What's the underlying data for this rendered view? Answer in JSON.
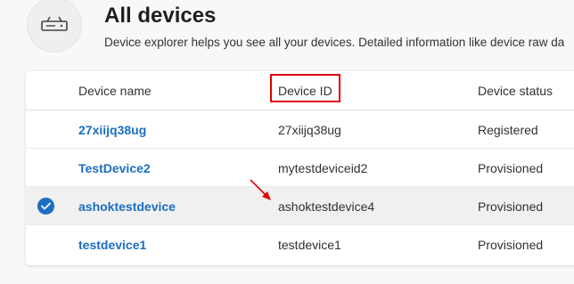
{
  "page": {
    "title": "All devices",
    "subtitle": "Device explorer helps you see all your devices. Detailed information like device raw da",
    "icon": "router-icon"
  },
  "table": {
    "columns": [
      "Device name",
      "Device ID",
      "Device status"
    ],
    "rows": [
      {
        "name": "27xiijq38ug",
        "id": "27xiijq38ug",
        "status": "Registered",
        "selected": false
      },
      {
        "name": "TestDevice2",
        "id": "mytestdeviceid2",
        "status": "Provisioned",
        "selected": false
      },
      {
        "name": "ashoktestdevice",
        "id": "ashoktestdevice4",
        "status": "Provisioned",
        "selected": true
      },
      {
        "name": "testdevice1",
        "id": "testdevice1",
        "status": "Provisioned",
        "selected": false
      }
    ]
  },
  "annotations": {
    "highlight_color": "#e00000",
    "highlighted_column": "Device ID",
    "arrow_target": "ashoktestdevice4"
  },
  "colors": {
    "accent": "#1b6ec2",
    "background": "#f8f8f8",
    "selected_row": "#f0f0f0"
  }
}
